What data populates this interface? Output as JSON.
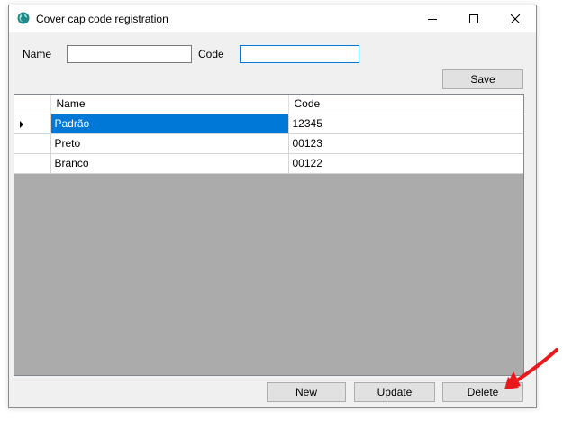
{
  "window": {
    "title": "Cover cap code registration",
    "icon": "app-globe-icon",
    "controls": [
      "minimize-icon",
      "maximize-icon",
      "close-icon"
    ]
  },
  "form": {
    "name_label": "Name",
    "name_value": "",
    "code_label": "Code",
    "code_value": "",
    "save_label": "Save"
  },
  "grid": {
    "columns": [
      "Name",
      "Code"
    ],
    "rows": [
      {
        "name": "Padrão",
        "code": "12345",
        "selected": true
      },
      {
        "name": "Preto",
        "code": "00123",
        "selected": false
      },
      {
        "name": "Branco",
        "code": "00122",
        "selected": false
      }
    ]
  },
  "actions": {
    "new_label": "New",
    "update_label": "Update",
    "delete_label": "Delete"
  },
  "colors": {
    "selection": "#0078d7",
    "grid_background": "#ababab",
    "annotation_arrow": "#e8191c"
  }
}
